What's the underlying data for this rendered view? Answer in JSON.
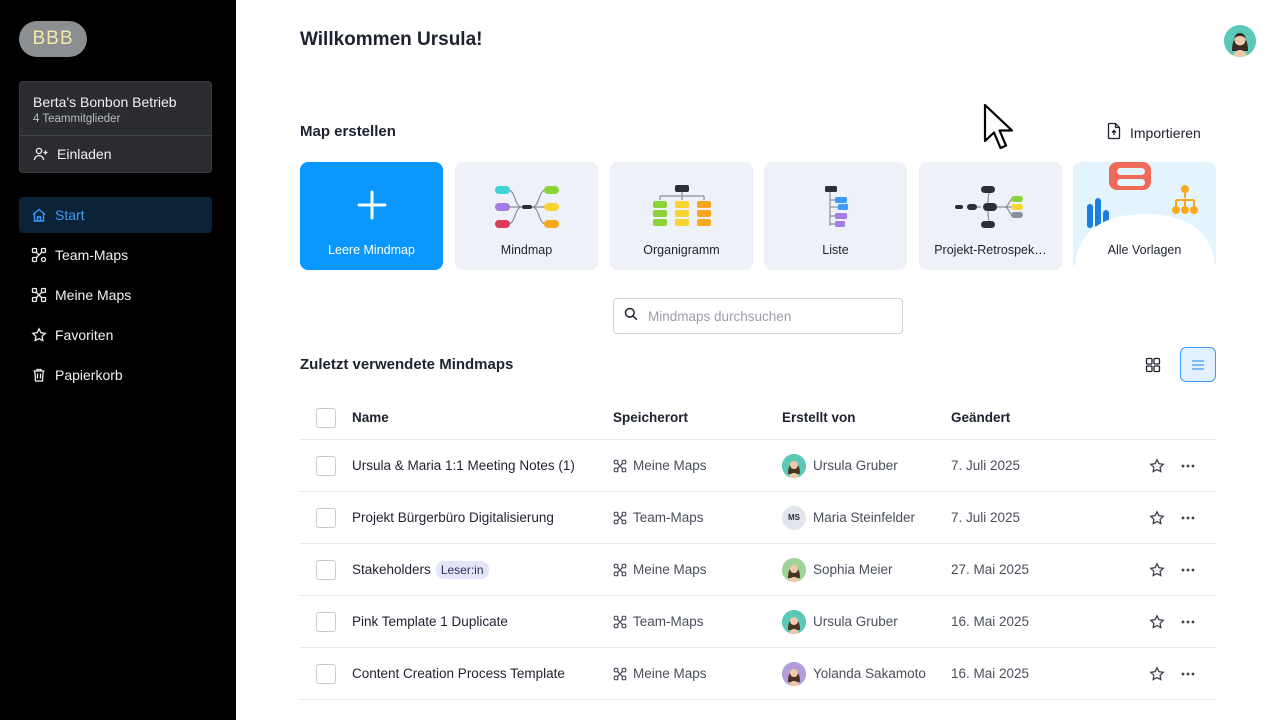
{
  "sidebar": {
    "workspace_initials": "BBB",
    "team_name": "Berta's Bonbon Betrieb",
    "team_members": "4 Teammitglieder",
    "invite_label": "Einladen",
    "nav": [
      {
        "label": "Start",
        "icon": "home-icon",
        "active": true
      },
      {
        "label": "Team-Maps",
        "icon": "team-maps-icon",
        "active": false
      },
      {
        "label": "Meine Maps",
        "icon": "my-maps-icon",
        "active": false
      },
      {
        "label": "Favoriten",
        "icon": "star-icon",
        "active": false
      },
      {
        "label": "Papierkorb",
        "icon": "trash-icon",
        "active": false
      }
    ]
  },
  "header": {
    "title": "Willkommen Ursula!"
  },
  "create": {
    "title": "Map erstellen",
    "import_label": "Importieren",
    "tiles": [
      {
        "label": "Leere Mindmap"
      },
      {
        "label": "Mindmap"
      },
      {
        "label": "Organigramm"
      },
      {
        "label": "Liste"
      },
      {
        "label": "Projekt-Retrospek…"
      },
      {
        "label": "Alle Vorlagen"
      }
    ]
  },
  "search": {
    "placeholder": "Mindmaps durchsuchen"
  },
  "recent": {
    "title": "Zuletzt verwendete Mindmaps",
    "columns": [
      "Name",
      "Speicherort",
      "Erstellt von",
      "Geändert"
    ],
    "rows": [
      {
        "name": "Ursula & Maria 1:1 Meeting Notes (1)",
        "badge": "",
        "location": "Meine Maps",
        "creator": "Ursula Gruber",
        "creator_initials": "",
        "avatar_color": "#5cc8b8",
        "date": "7. Juli 2025"
      },
      {
        "name": "Projekt Bürgerbüro Digitalisierung",
        "badge": "",
        "location": "Team-Maps",
        "creator": "Maria Steinfelder",
        "creator_initials": "MS",
        "avatar_color": "#e3e5ee",
        "date": "7. Juli 2025"
      },
      {
        "name": "Stakeholders",
        "badge": "Leser:in",
        "location": "Meine Maps",
        "creator": "Sophia Meier",
        "creator_initials": "",
        "avatar_color": "#9fd39a",
        "date": "27. Mai 2025"
      },
      {
        "name": "Pink Template 1 Duplicate",
        "badge": "",
        "location": "Team-Maps",
        "creator": "Ursula Gruber",
        "creator_initials": "",
        "avatar_color": "#5cc8b8",
        "date": "16. Mai 2025"
      },
      {
        "name": "Content Creation Process Template",
        "badge": "",
        "location": "Meine Maps",
        "creator": "Yolanda Sakamoto",
        "creator_initials": "",
        "avatar_color": "#b39ddb",
        "date": "16. Mai 2025"
      }
    ]
  },
  "colors": {
    "accent": "#0a97ff",
    "active_nav_text": "#3d9bff",
    "sidebar_bg": "#000000"
  }
}
